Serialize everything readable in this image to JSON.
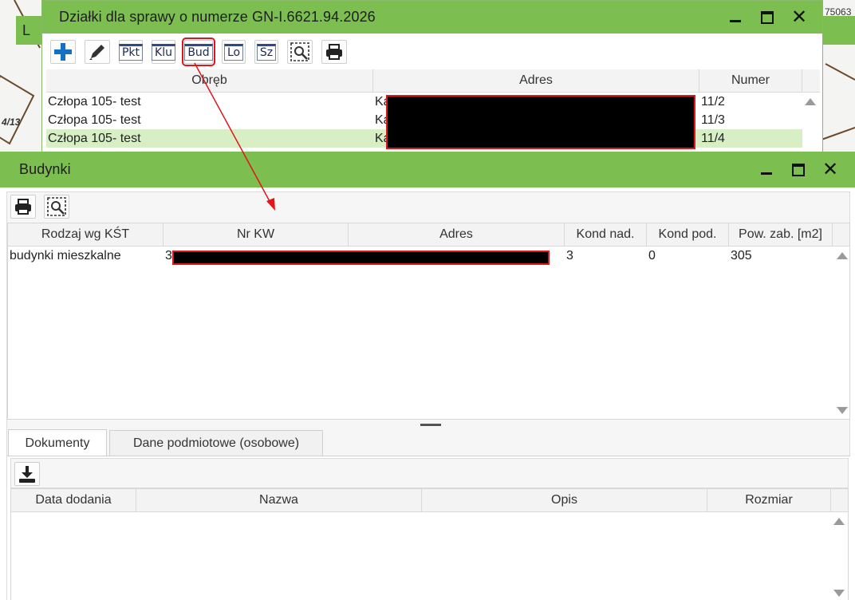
{
  "background": {
    "left_tab_label": "L",
    "map_parcel_label": "4/13",
    "corner_text": "75063"
  },
  "dzialki_window": {
    "title": "Działki dla sprawy o numerze GN-I.6621.94.2026",
    "toolbar": [
      {
        "name": "add-button",
        "icon": "plus-icon"
      },
      {
        "name": "edit-button",
        "icon": "pencil-icon"
      },
      {
        "name": "pkt-button",
        "label": "Pkt"
      },
      {
        "name": "klu-button",
        "label": "Klu"
      },
      {
        "name": "bud-button",
        "label": "Bud",
        "highlighted": true
      },
      {
        "name": "lo-button",
        "label": "Lo"
      },
      {
        "name": "sz-button",
        "label": "Sz"
      },
      {
        "name": "zoom-select-button",
        "icon": "zoom-select-icon"
      },
      {
        "name": "print-button",
        "icon": "printer-icon"
      }
    ],
    "columns": [
      "Obręb",
      "Adres",
      "Numer"
    ],
    "rows": [
      {
        "obreb": "Człopa 105- test",
        "adres": "Ka",
        "numer": "11/2",
        "selected": false
      },
      {
        "obreb": "Człopa 105- test",
        "adres": "Ka",
        "numer": "11/3",
        "selected": false
      },
      {
        "obreb": "Człopa 105- test",
        "adres": "Ka",
        "numer": "11/4",
        "selected": true
      }
    ]
  },
  "budynki_window": {
    "title": "Budynki",
    "toolbar": [
      {
        "name": "print-button",
        "icon": "printer-icon"
      },
      {
        "name": "zoom-select-button",
        "icon": "zoom-select-icon"
      }
    ],
    "columns": [
      "Rodzaj wg KŚT",
      "Nr KW",
      "Adres",
      "Kond nad.",
      "Kond pod.",
      "Pow. zab. [m2]"
    ],
    "rows": [
      {
        "rodzaj": "budynki mieszkalne",
        "nr_kw": "3",
        "adres": "",
        "kond_nad": "3",
        "kond_pod": "0",
        "pow_zab": "305"
      }
    ],
    "tabs": [
      {
        "label": "Dokumenty",
        "active": true
      },
      {
        "label": "Dane podmiotowe (osobowe)",
        "active": false
      }
    ],
    "docs_toolbar": [
      {
        "name": "download-button",
        "icon": "download-icon"
      }
    ],
    "docs_columns": [
      "Data dodania",
      "Nazwa",
      "Opis",
      "Rozmiar"
    ]
  },
  "colors": {
    "titlebar": "#7cbe50",
    "selected_row": "#d8efc6",
    "annotation_red": "#e0161b"
  }
}
